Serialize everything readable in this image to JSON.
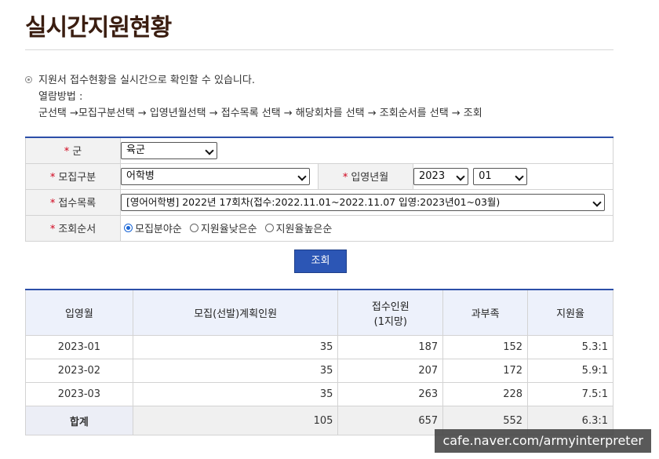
{
  "page": {
    "title": "실시간지원현황"
  },
  "info": {
    "line1": "지원서 접수현황을 실시간으로 확인할 수 있습니다.",
    "line2": "열람방법 :",
    "line3": "군선택 →모집구분선택 → 입영년월선택 → 접수목록 선택 → 해당회차를 선택 → 조회순서를 선택 → 조회"
  },
  "form": {
    "required_mark": "*",
    "branch_label": "군",
    "branch_value": "육군",
    "recruit_label": "모집구분",
    "recruit_value": "어학병",
    "enlist_label": "입영년월",
    "enlist_year": "2023",
    "enlist_month": "01",
    "list_label": "접수목록",
    "list_value": "[영어어학병] 2022년 17회차(접수:2022.11.01~2022.11.07 입영:2023년01~03월)",
    "order_label": "조회순서",
    "order_options": [
      "모집분야순",
      "지원율낮은순",
      "지원율높은순"
    ],
    "selected_order": 0,
    "search_button": "조회"
  },
  "table": {
    "headers": [
      "입영월",
      "모집(선발)계획인원",
      "접수인원",
      "(1지망)",
      "과부족",
      "지원율"
    ],
    "rows": [
      {
        "month": "2023-01",
        "planned": "35",
        "applied": "187",
        "surplus": "152",
        "rate": "5.3:1"
      },
      {
        "month": "2023-02",
        "planned": "35",
        "applied": "207",
        "surplus": "172",
        "rate": "5.9:1"
      },
      {
        "month": "2023-03",
        "planned": "35",
        "applied": "263",
        "surplus": "228",
        "rate": "7.5:1"
      }
    ],
    "total": {
      "label": "합계",
      "planned": "105",
      "applied": "657",
      "surplus": "552",
      "rate": "6.3:1"
    }
  },
  "watermark": "cafe.naver.com/armyinterpreter",
  "colors": {
    "accent": "#2c4fa8",
    "required": "#d0021b",
    "title": "#3a1d10"
  }
}
